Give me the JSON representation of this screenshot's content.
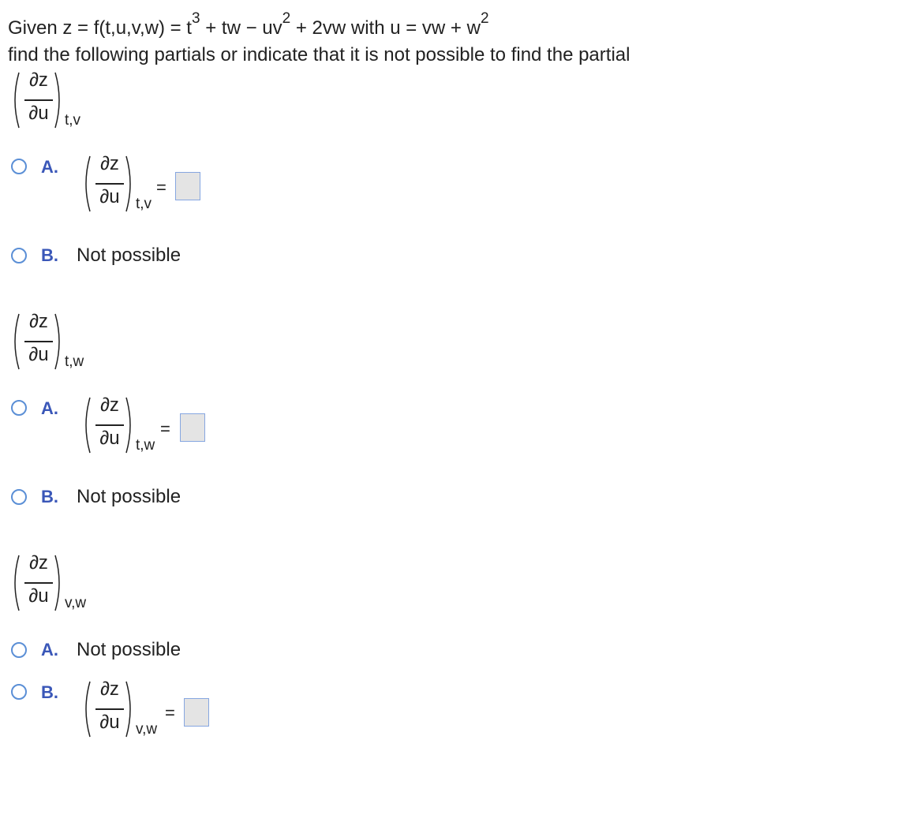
{
  "problem": {
    "given_prefix": "Given z = f(t,u,v,w) = t",
    "exp_t": "3",
    "mid1": " + tw − uv",
    "exp_v": "2",
    "mid2": " + 2vw  with u = vw + w",
    "exp_w": "2",
    "instruction": "find the following partials or indicate that it is not possible to find the partial"
  },
  "fraction": {
    "numerator": "∂z",
    "denominator": "∂u"
  },
  "parts": [
    {
      "subscript": "t,v",
      "option_a": {
        "letter": "A.",
        "subscript": "t,v",
        "equals": "="
      },
      "option_b": {
        "letter": "B.",
        "text": "Not possible"
      }
    },
    {
      "subscript": "t,w",
      "option_a": {
        "letter": "A.",
        "subscript": "t,w",
        "equals": "="
      },
      "option_b": {
        "letter": "B.",
        "text": "Not possible"
      }
    },
    {
      "subscript": "v,w",
      "option_a": {
        "letter": "A.",
        "text": "Not possible"
      },
      "option_b": {
        "letter": "B.",
        "subscript": "v,w",
        "equals": "="
      }
    }
  ]
}
